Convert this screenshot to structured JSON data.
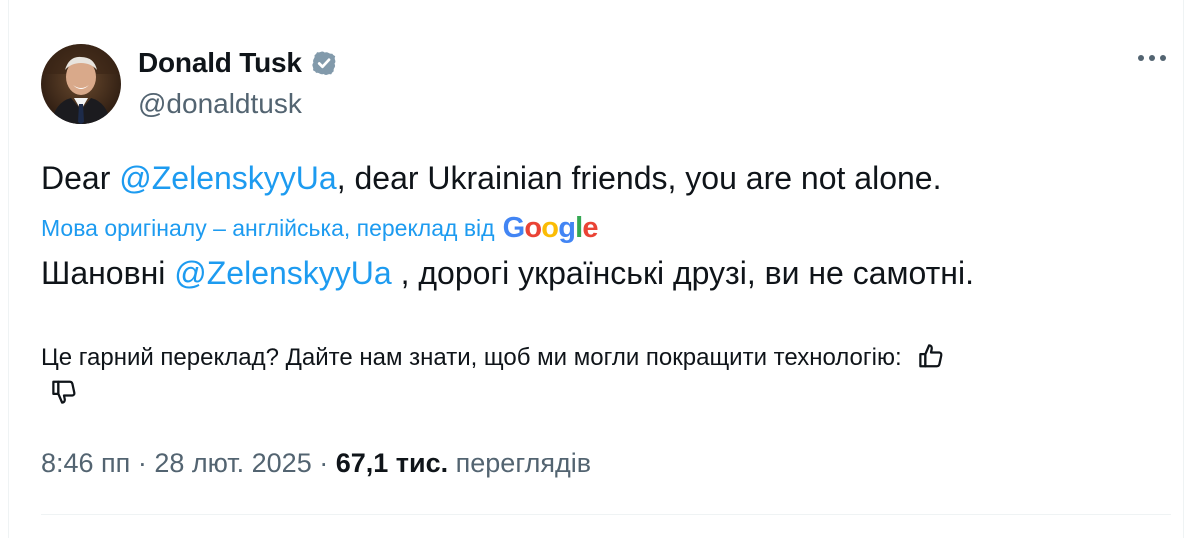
{
  "tweet": {
    "author": {
      "display_name": "Donald Tusk",
      "handle": "@donaldtusk",
      "verified_icon": "verified-badge-icon",
      "avatar": "profile-photo"
    },
    "more_icon": "more-dots-icon",
    "text_before_mention": "Dear ",
    "text_mention": "@ZelenskyyUa",
    "text_after_mention": ", dear Ukrainian friends, you are not alone.",
    "translation": {
      "source_label": "Мова оригіналу – англійська, переклад від",
      "provider": "Google",
      "text_before_mention": "Шановні ",
      "text_mention": "@ZelenskyyUa",
      "text_after_mention": " , дорогі українські друзі, ви не самотні."
    },
    "feedback": {
      "question": "Це гарний переклад? Дайте нам знати, щоб ми могли покращити технологію:",
      "up_icon": "thumbs-up-icon",
      "down_icon": "thumbs-down-icon"
    },
    "meta": {
      "time": "8:46 пп",
      "separator": "·",
      "date": "28 лют. 2025",
      "views_count": "67,1 тис.",
      "views_label": "переглядів"
    }
  },
  "colors": {
    "accent": "#1d9bf0",
    "text": "#0f1419",
    "secondary": "#536471",
    "divider": "#eff3f4"
  }
}
